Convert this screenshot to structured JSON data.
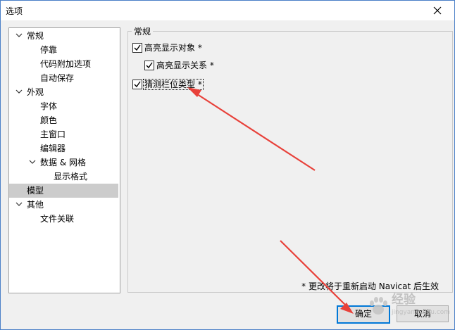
{
  "window": {
    "title": "选项"
  },
  "tree": {
    "items": [
      {
        "label": "常规"
      },
      {
        "label": "停靠"
      },
      {
        "label": "代码附加选项"
      },
      {
        "label": "自动保存"
      },
      {
        "label": "外观"
      },
      {
        "label": "字体"
      },
      {
        "label": "颜色"
      },
      {
        "label": "主窗口"
      },
      {
        "label": "编辑器"
      },
      {
        "label": "数据 & 网格"
      },
      {
        "label": "显示格式"
      },
      {
        "label": "模型"
      },
      {
        "label": "其他"
      },
      {
        "label": "文件关联"
      }
    ],
    "selected": "模型"
  },
  "panel": {
    "group_title": "常规",
    "options": [
      {
        "label": "高亮显示对象 *",
        "checked": true
      },
      {
        "label": "高亮显示关系 *",
        "checked": true
      },
      {
        "label": "猜测栏位类型 *",
        "checked": true
      }
    ],
    "note": "* 更改将于重新启动 Navicat 后生效"
  },
  "buttons": {
    "ok": "确定",
    "cancel": "取消"
  },
  "annotations": {
    "arrow_color": "#e8413a"
  },
  "watermark": {
    "text": "经验",
    "sub": "jingyan.baidu.com"
  }
}
